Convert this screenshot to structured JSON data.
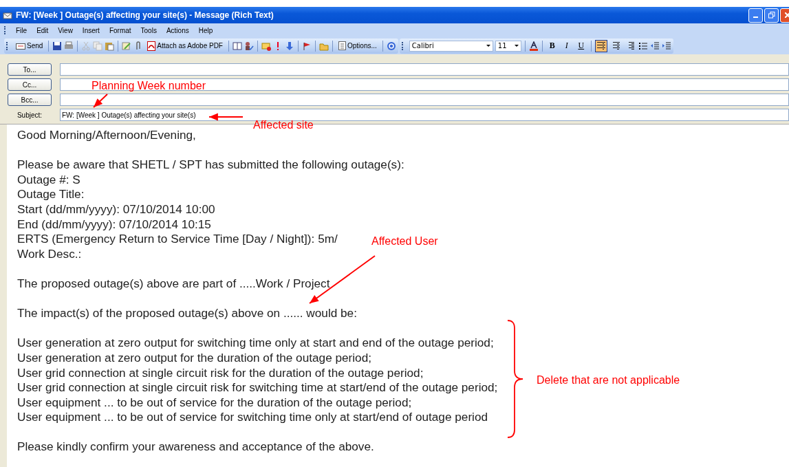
{
  "window": {
    "title": "FW: [Week ] Outage(s) affecting your site(s) - Message (Rich Text)"
  },
  "menu": [
    "File",
    "Edit",
    "View",
    "Insert",
    "Format",
    "Tools",
    "Actions",
    "Help"
  ],
  "toolbar": {
    "send": "Send",
    "attach_pdf": "Attach as Adobe PDF",
    "options": "Options...",
    "font": "Calibri",
    "size": "11",
    "styles": [
      "B",
      "I",
      "U"
    ],
    "alignment": [
      {
        "selected": true
      },
      {
        "selected": false
      },
      {
        "selected": false
      }
    ]
  },
  "address": [
    {
      "button": "To..."
    },
    {
      "button": "Cc..."
    },
    {
      "button": "Bcc..."
    }
  ],
  "subject": {
    "label": "Subject:",
    "value": "FW: [Week ] Outage(s) affecting your site(s)"
  },
  "body": [
    [
      "Good Morning/Afternoon/Evening,"
    ],
    [
      "Please be aware that SHETL / SPT has submitted the following outage(s):",
      "Outage #: S",
      "Outage Title:",
      "Start (dd/mm/yyyy):  07/10/2014 10:00",
      "End (dd/mm/yyyy):  07/10/2014 10:15",
      "ERTS (Emergency Return to Service Time [Day / Night]): 5m/",
      "Work Desc.:"
    ],
    [
      "The proposed outage(s) above are part of .....Work / Project"
    ],
    [
      "The impact(s) of the proposed outage(s) above on ...... would be:"
    ],
    [
      "User generation at zero output for switching time only at start and end of the outage period;",
      "User generation at zero output for the duration of the outage period;",
      "User grid connection at single circuit risk for the duration of the outage period;",
      "User grid connection at single circuit risk for switching time at start/end of the outage period;",
      "User equipment ... to be out of service for the duration of the outage period;",
      "User equipment ... to be out of service for switching time only at start/end of outage period"
    ],
    [
      "Please kindly confirm your awareness and acceptance of the above."
    ]
  ],
  "annotations": [
    {
      "kind": "week",
      "text": "Planning Week number"
    },
    {
      "kind": "site",
      "text": "Affected site"
    },
    {
      "kind": "user",
      "text": "Affected User"
    },
    {
      "kind": "brace",
      "text": "Delete that are not applicable"
    }
  ]
}
